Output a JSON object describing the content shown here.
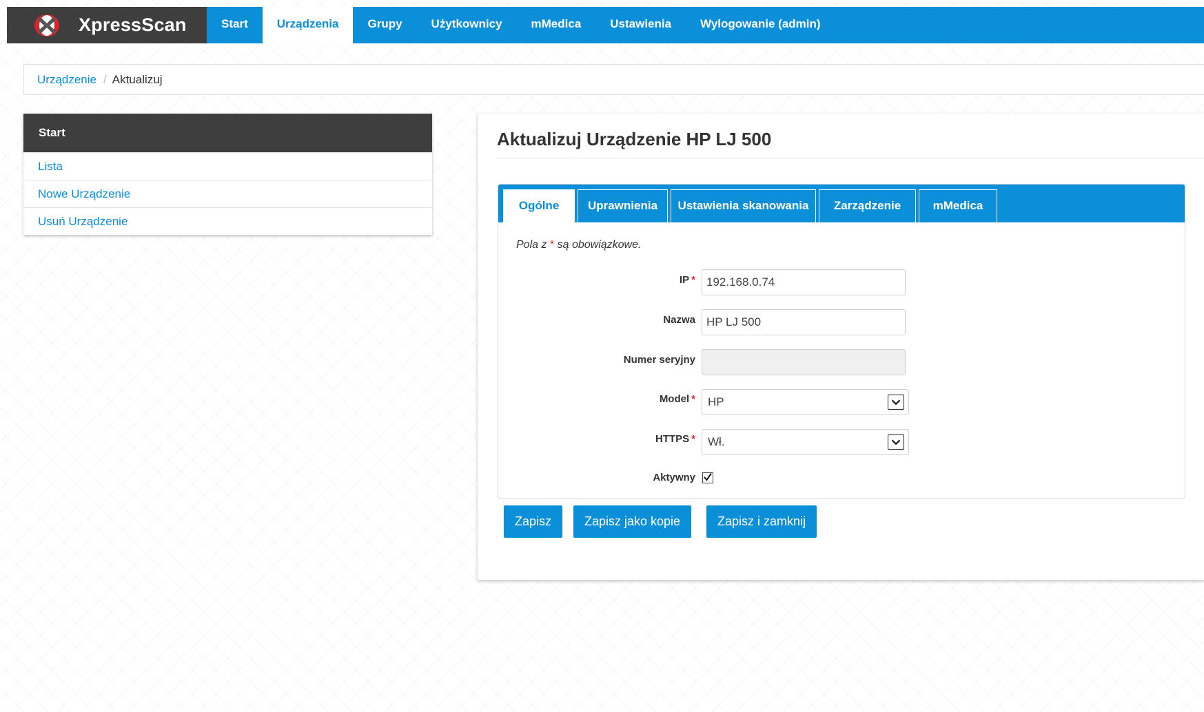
{
  "navbar": {
    "brand": "XpressScan",
    "items": [
      {
        "label": "Start",
        "active": false
      },
      {
        "label": "Urządzenia",
        "active": true
      },
      {
        "label": "Grupy",
        "active": false
      },
      {
        "label": "Użytkownicy",
        "active": false
      },
      {
        "label": "mMedica",
        "active": false
      },
      {
        "label": "Ustawienia",
        "active": false
      },
      {
        "label": "Wylogowanie (admin)",
        "active": false
      }
    ]
  },
  "breadcrumb": {
    "parent": "Urządzenie",
    "separator": "/",
    "current": "Aktualizuj"
  },
  "sidebar": {
    "title": "Start",
    "items": [
      {
        "label": "Lista"
      },
      {
        "label": "Nowe Urządzenie"
      },
      {
        "label": "Usuń Urządzenie"
      }
    ]
  },
  "main": {
    "title": "Aktualizuj Urządzenie HP LJ 500",
    "tabs": [
      {
        "label": "Ogólne",
        "active": true
      },
      {
        "label": "Uprawnienia",
        "active": false
      },
      {
        "label": "Ustawienia skanowania",
        "active": false
      },
      {
        "label": "Zarządzenie",
        "active": false
      },
      {
        "label": "mMedica",
        "active": false
      }
    ],
    "required_note_prefix": "Pola z",
    "required_star": "*",
    "required_note_suffix": "są obowiązkowe.",
    "form": {
      "ip": {
        "label": "IP",
        "required": true,
        "value": "192.168.0.74"
      },
      "name": {
        "label": "Nazwa",
        "required": false,
        "value": "HP LJ 500"
      },
      "serial": {
        "label": "Numer seryjny",
        "required": false,
        "value": "",
        "disabled": true
      },
      "model": {
        "label": "Model",
        "required": true,
        "value": "HP"
      },
      "https": {
        "label": "HTTPS",
        "required": true,
        "value": "Wł."
      },
      "active": {
        "label": "Aktywny",
        "checked": true
      }
    },
    "buttons": {
      "save": "Zapisz",
      "save_copy": "Zapisz jako kopie",
      "save_close": "Zapisz i zamknij"
    }
  },
  "colors": {
    "accent": "#0b8fd9",
    "dark": "#3e3e3e",
    "required": "#d9252a"
  }
}
